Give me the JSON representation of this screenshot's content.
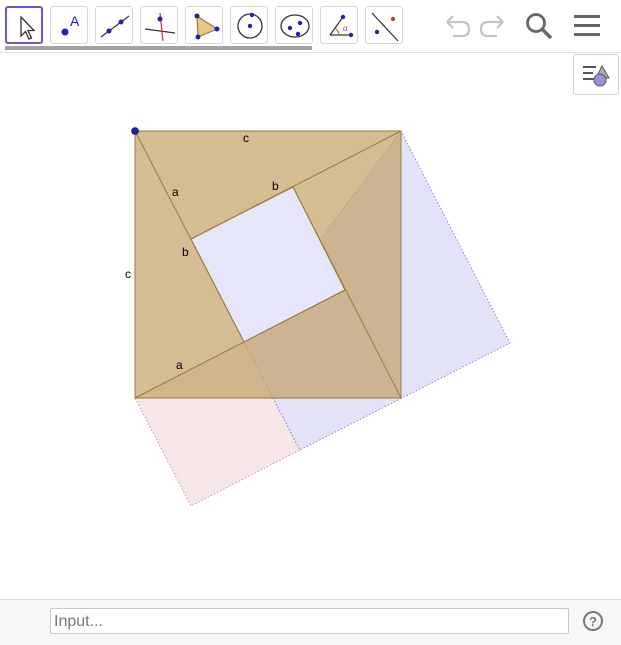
{
  "toolbar": {
    "tools": [
      {
        "icon": "move-arrow-icon",
        "active": true
      },
      {
        "icon": "point-icon",
        "active": false
      },
      {
        "icon": "line-icon",
        "active": false
      },
      {
        "icon": "perpendicular-line-icon",
        "active": false
      },
      {
        "icon": "polygon-icon",
        "active": false
      },
      {
        "icon": "circle-center-point-icon",
        "active": false
      },
      {
        "icon": "ellipse-icon",
        "active": false
      },
      {
        "icon": "angle-icon",
        "active": false
      },
      {
        "icon": "reflect-about-line-icon",
        "active": false
      }
    ],
    "point_tool_glyph": "A",
    "angle_tool_glyph": "α",
    "undo_icon": "undo-icon",
    "redo_icon": "redo-icon",
    "search_icon": "search-icon",
    "menu_icon": "menu-icon",
    "style_bar_icon": "graphics-style-icon"
  },
  "graphics": {
    "labels": {
      "top_side": "c",
      "left_side": "c",
      "hyp_a_upper": "a",
      "leg_b_upper": "b",
      "leg_b_left": "b",
      "leg_a_lower": "a"
    },
    "colors": {
      "square_fill": "#c4a26a",
      "square_stroke": "#9b7b3a",
      "inner_square_fill": "#e6e6fa",
      "blue_square_fill": "#d6d6f7",
      "blue_square_stroke": "#6f6fcf",
      "pink_square_fill": "#f3dcdc",
      "pink_square_stroke": "#d08080",
      "point_color": "#1e22b4"
    }
  },
  "input_bar": {
    "placeholder": "Input...",
    "help_label": "?"
  }
}
